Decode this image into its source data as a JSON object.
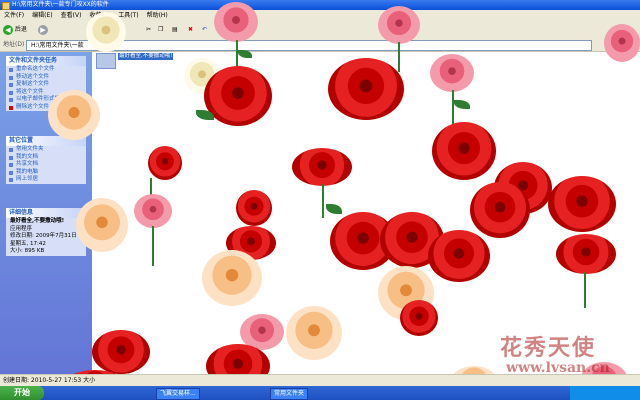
{
  "window": {
    "title": "H:\\常用文件夹\\一款专门攻XX的软件"
  },
  "menu": [
    "文件(F)",
    "编辑(E)",
    "查看(V)",
    "收藏(A)",
    "工具(T)",
    "帮助(H)"
  ],
  "toolbar": {
    "back_label": "后退"
  },
  "address": {
    "label": "地址(D)",
    "value": "H:\\常用文件夹\\一款"
  },
  "file": {
    "label": "最好看全,不要撒动哦!"
  },
  "sidebar": {
    "tasks": {
      "title": "文件和文件夹任务",
      "items": [
        "重命名这个文件",
        "移动这个文件",
        "复制这个文件",
        "将这个文件",
        "以电子邮件形式发送此文件",
        "删除这个文件"
      ]
    },
    "places": {
      "title": "其它位置",
      "items": [
        "常用文件夹",
        "我的文档",
        "共享文档",
        "我的电脑",
        "网上邻居"
      ]
    },
    "details": {
      "title": "详细信息",
      "name": "最好看全,不要撒动哦!",
      "type": "应用程序",
      "modified": "修改日期: 2009年7月31日",
      "time": "星期五, 17:42",
      "size": "大小: 895 KB"
    }
  },
  "status": {
    "text": "创建日期: 2010-5-27 17:53 大小"
  },
  "taskbar": {
    "start_label": "开始",
    "tasks": [
      "飞翼交易样...",
      "常用文件夹"
    ]
  },
  "watermark": {
    "text": "花秀天使",
    "url": "www.lvsan.cn"
  }
}
